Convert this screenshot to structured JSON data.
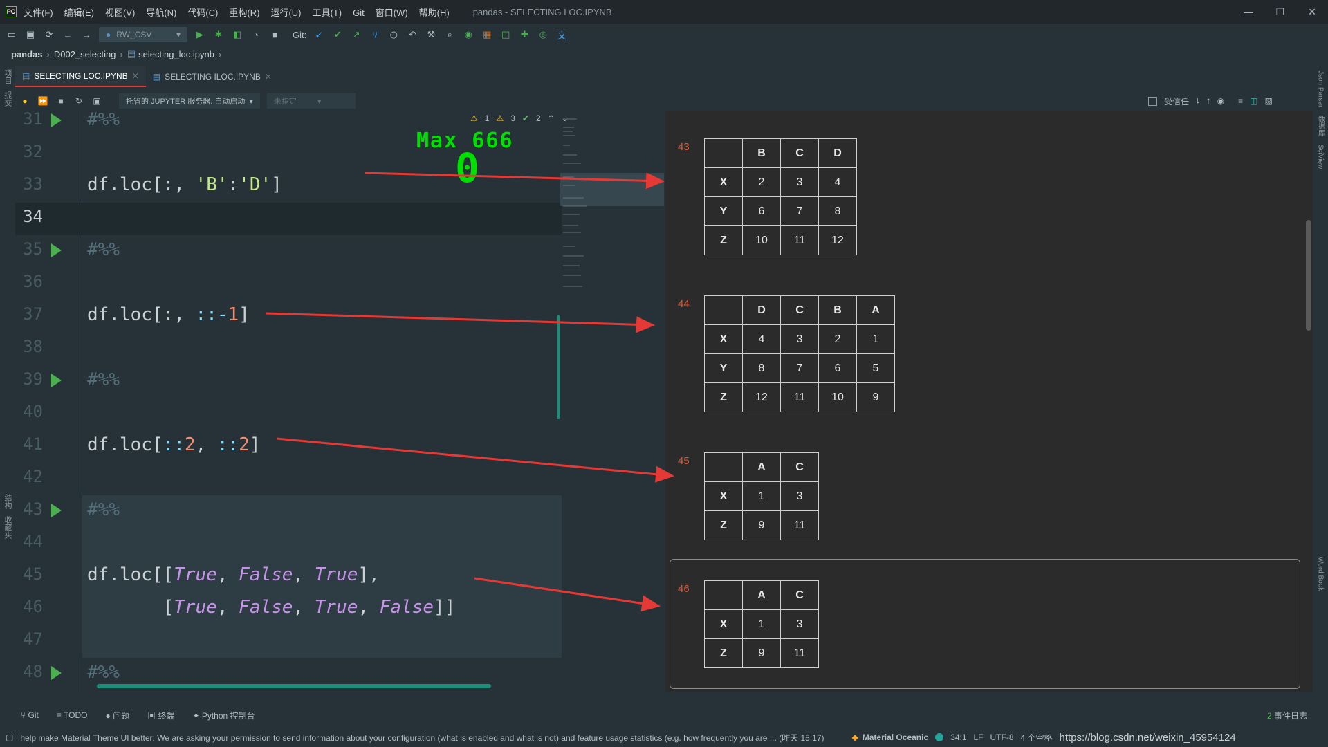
{
  "window": {
    "title": "pandas - SELECTING LOC.IPYNB",
    "menu": [
      "文件(F)",
      "编辑(E)",
      "视图(V)",
      "导航(N)",
      "代码(C)",
      "重构(R)",
      "运行(U)",
      "工具(T)",
      "Git",
      "窗口(W)",
      "帮助(H)"
    ],
    "controls": {
      "minimize": "—",
      "maximize": "❐",
      "close": "✕"
    }
  },
  "toolbar": {
    "run_config": "RW_CSV",
    "git_label": "Git:"
  },
  "breadcrumb": [
    "pandas",
    "D002_selecting",
    "selecting_loc.ipynb"
  ],
  "tabs": [
    {
      "label": "SELECTING LOC.IPYNB",
      "active": true
    },
    {
      "label": "SELECTING ILOC.IPYNB",
      "active": false
    }
  ],
  "notebook_bar": {
    "server": "托管的 JUPYTER 服务器: 自动启动",
    "kernel": "未指定",
    "trusted": "受信任"
  },
  "inspections": {
    "warnings": "1",
    "weak_warnings": "3",
    "ok": "2"
  },
  "overlay": {
    "max_label": "Max 666",
    "counter": "0"
  },
  "left_strip": [
    "项目",
    "提交",
    "结构",
    "收藏夹"
  ],
  "right_strip": [
    "Json Parser",
    "数据库",
    "SciView",
    "Word Book"
  ],
  "code_lines": [
    {
      "n": "31",
      "kind": "cell"
    },
    {
      "n": "32"
    },
    {
      "n": "33",
      "code": "df.loc[:, 'B':'D']"
    },
    {
      "n": "34",
      "current": true
    },
    {
      "n": "35",
      "kind": "cell"
    },
    {
      "n": "36"
    },
    {
      "n": "37",
      "code": "df.loc[:, ::-1]"
    },
    {
      "n": "38"
    },
    {
      "n": "39",
      "kind": "cell"
    },
    {
      "n": "40"
    },
    {
      "n": "41",
      "code": "df.loc[::2, ::2]"
    },
    {
      "n": "42"
    },
    {
      "n": "43",
      "kind": "cell"
    },
    {
      "n": "44"
    },
    {
      "n": "45",
      "code": "df.loc[[True, False, True],"
    },
    {
      "n": "46",
      "code": "       [True, False, True, False]]"
    },
    {
      "n": "47"
    },
    {
      "n": "48",
      "kind": "cell"
    }
  ],
  "cell_marker": "#%%",
  "outputs": [
    {
      "num": "43",
      "columns": [
        "",
        "B",
        "C",
        "D"
      ],
      "rows": [
        [
          "X",
          "2",
          "3",
          "4"
        ],
        [
          "Y",
          "6",
          "7",
          "8"
        ],
        [
          "Z",
          "10",
          "11",
          "12"
        ]
      ]
    },
    {
      "num": "44",
      "columns": [
        "",
        "D",
        "C",
        "B",
        "A"
      ],
      "rows": [
        [
          "X",
          "4",
          "3",
          "2",
          "1"
        ],
        [
          "Y",
          "8",
          "7",
          "6",
          "5"
        ],
        [
          "Z",
          "12",
          "11",
          "10",
          "9"
        ]
      ]
    },
    {
      "num": "45",
      "columns": [
        "",
        "A",
        "C"
      ],
      "rows": [
        [
          "X",
          "1",
          "3"
        ],
        [
          "Z",
          "9",
          "11"
        ]
      ]
    },
    {
      "num": "46",
      "columns": [
        "",
        "A",
        "C"
      ],
      "rows": [
        [
          "X",
          "1",
          "3"
        ],
        [
          "Z",
          "9",
          "11"
        ]
      ]
    }
  ],
  "tool_windows": [
    "Git",
    "TODO",
    "问题",
    "终端",
    "Python 控制台"
  ],
  "event_log": "事件日志",
  "event_count": "2",
  "status": {
    "message": "help make Material Theme UI better: We are asking your permission to send information about your configuration (what is enabled and what is not) and feature usage statistics (e.g. how frequently you are ... (昨天 15:17)",
    "theme": "Material Oceanic",
    "position": "34:1",
    "line_sep": "LF",
    "encoding": "UTF-8",
    "indent": "4 个空格",
    "watermark": "https://blog.csdn.net/weixin_45954124"
  }
}
